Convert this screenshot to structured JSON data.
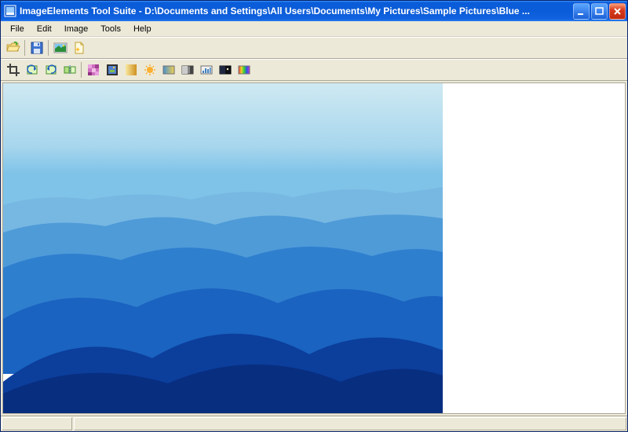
{
  "window": {
    "title": "ImageElements Tool Suite - D:\\Documents and Settings\\All Users\\Documents\\My Pictures\\Sample Pictures\\Blue ..."
  },
  "menu": {
    "file": "File",
    "edit": "Edit",
    "image": "Image",
    "tools": "Tools",
    "help": "Help"
  },
  "toolbar1": {
    "open": "open",
    "save": "save",
    "print": "print",
    "new": "new"
  },
  "toolbar2": {
    "crop": "crop",
    "rotate_left": "rotate-left",
    "rotate_right": "rotate-right",
    "flip": "flip",
    "pixelate": "pixelate",
    "border": "border",
    "brightness": "brightness",
    "sun": "sun",
    "gradient_h": "gradient-horizontal",
    "grayscale": "grayscale",
    "levels": "levels",
    "invert": "invert",
    "hue": "hue"
  },
  "colors": {
    "titlebar_a": "#3a95ff",
    "titlebar_b": "#0b5cd8",
    "close_a": "#f89e7a",
    "close_b": "#c02a10",
    "face": "#ece9d8",
    "shadow": "#aca899"
  },
  "statusbar": {
    "cell1": "",
    "cell2": ""
  }
}
